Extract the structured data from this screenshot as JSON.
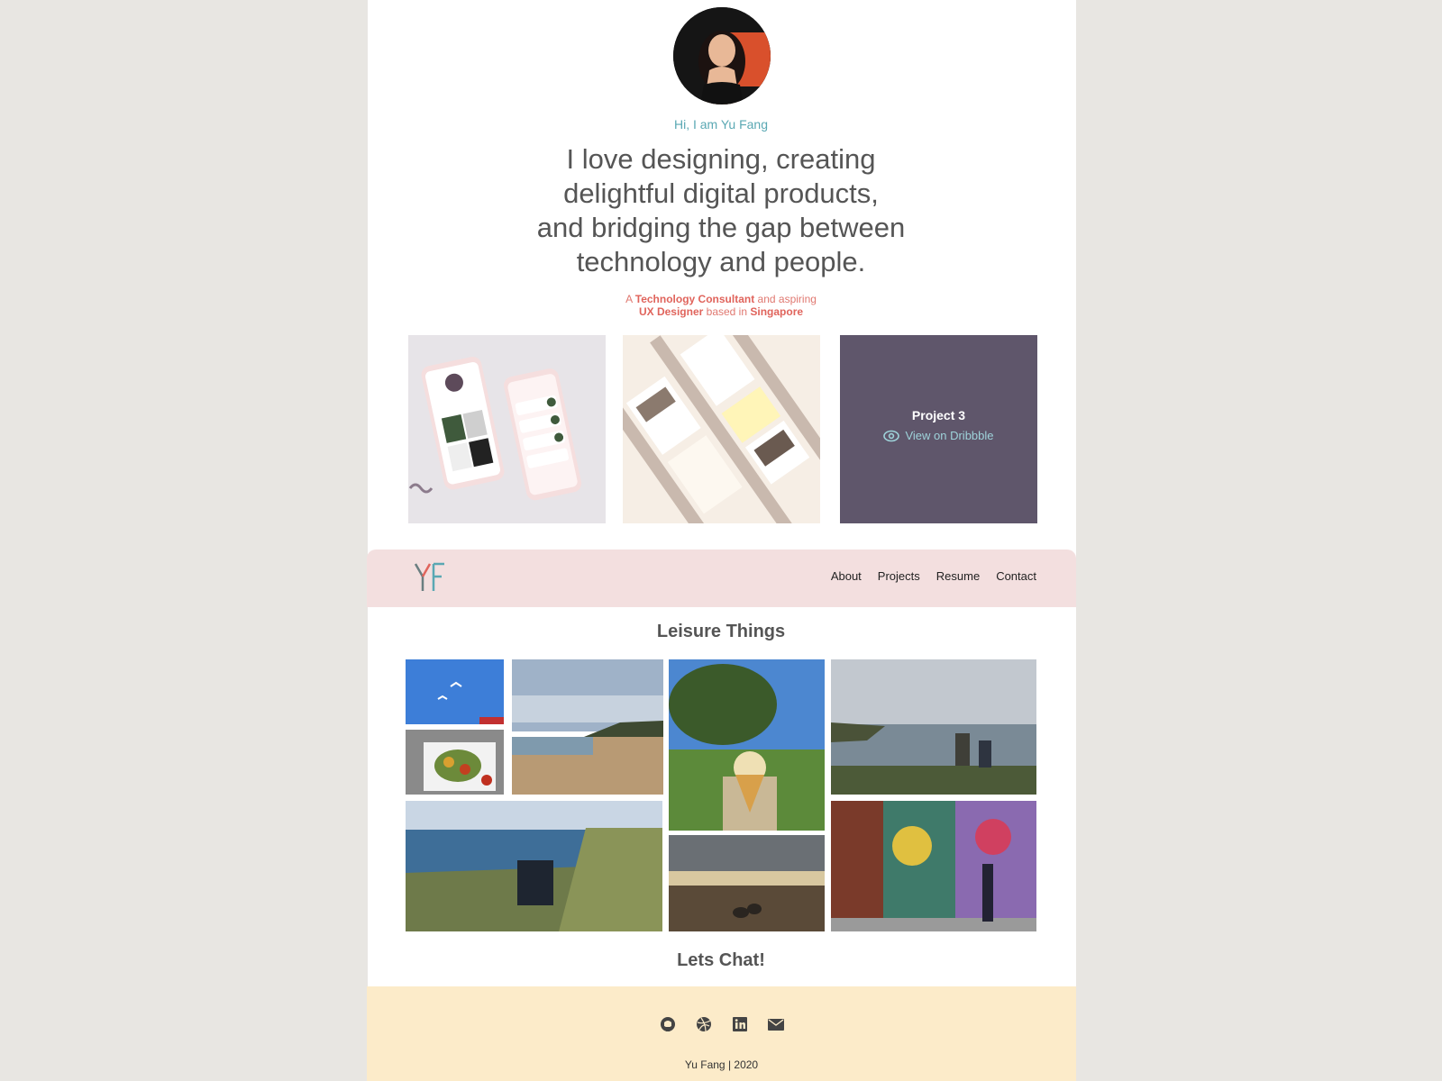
{
  "hero": {
    "greeting": "Hi, I am Yu Fang",
    "headline": [
      "I love designing, creating",
      "delightful digital products,",
      "and bridging the gap between",
      "technology and people."
    ],
    "tagline": {
      "part1": "A ",
      "role1": "Technology Consultant",
      "part2": " and aspiring",
      "role2": "UX Designer",
      "part3": " based in ",
      "location": "Singapore"
    }
  },
  "projects": [
    {
      "id": "project-1"
    },
    {
      "id": "project-2"
    },
    {
      "title": "Project 3",
      "link_label": "View on Dribbble",
      "icon": "eye-icon"
    }
  ],
  "nav": {
    "logo_text": "YF",
    "links": [
      "About",
      "Projects",
      "Resume",
      "Contact"
    ]
  },
  "leisure": {
    "title": "Leisure Things"
  },
  "chat": {
    "title": "Lets Chat!"
  },
  "footer": {
    "icons": [
      "github-icon",
      "dribbble-icon",
      "linkedin-icon",
      "email-icon"
    ],
    "copyright": "Yu Fang | 2020"
  },
  "colors": {
    "accent_teal": "#5aa8b3",
    "accent_coral": "#e0645c",
    "nav_bg": "#f3dfdf",
    "footer_bg": "#fcebc9",
    "project3_bg": "#5f566b"
  }
}
